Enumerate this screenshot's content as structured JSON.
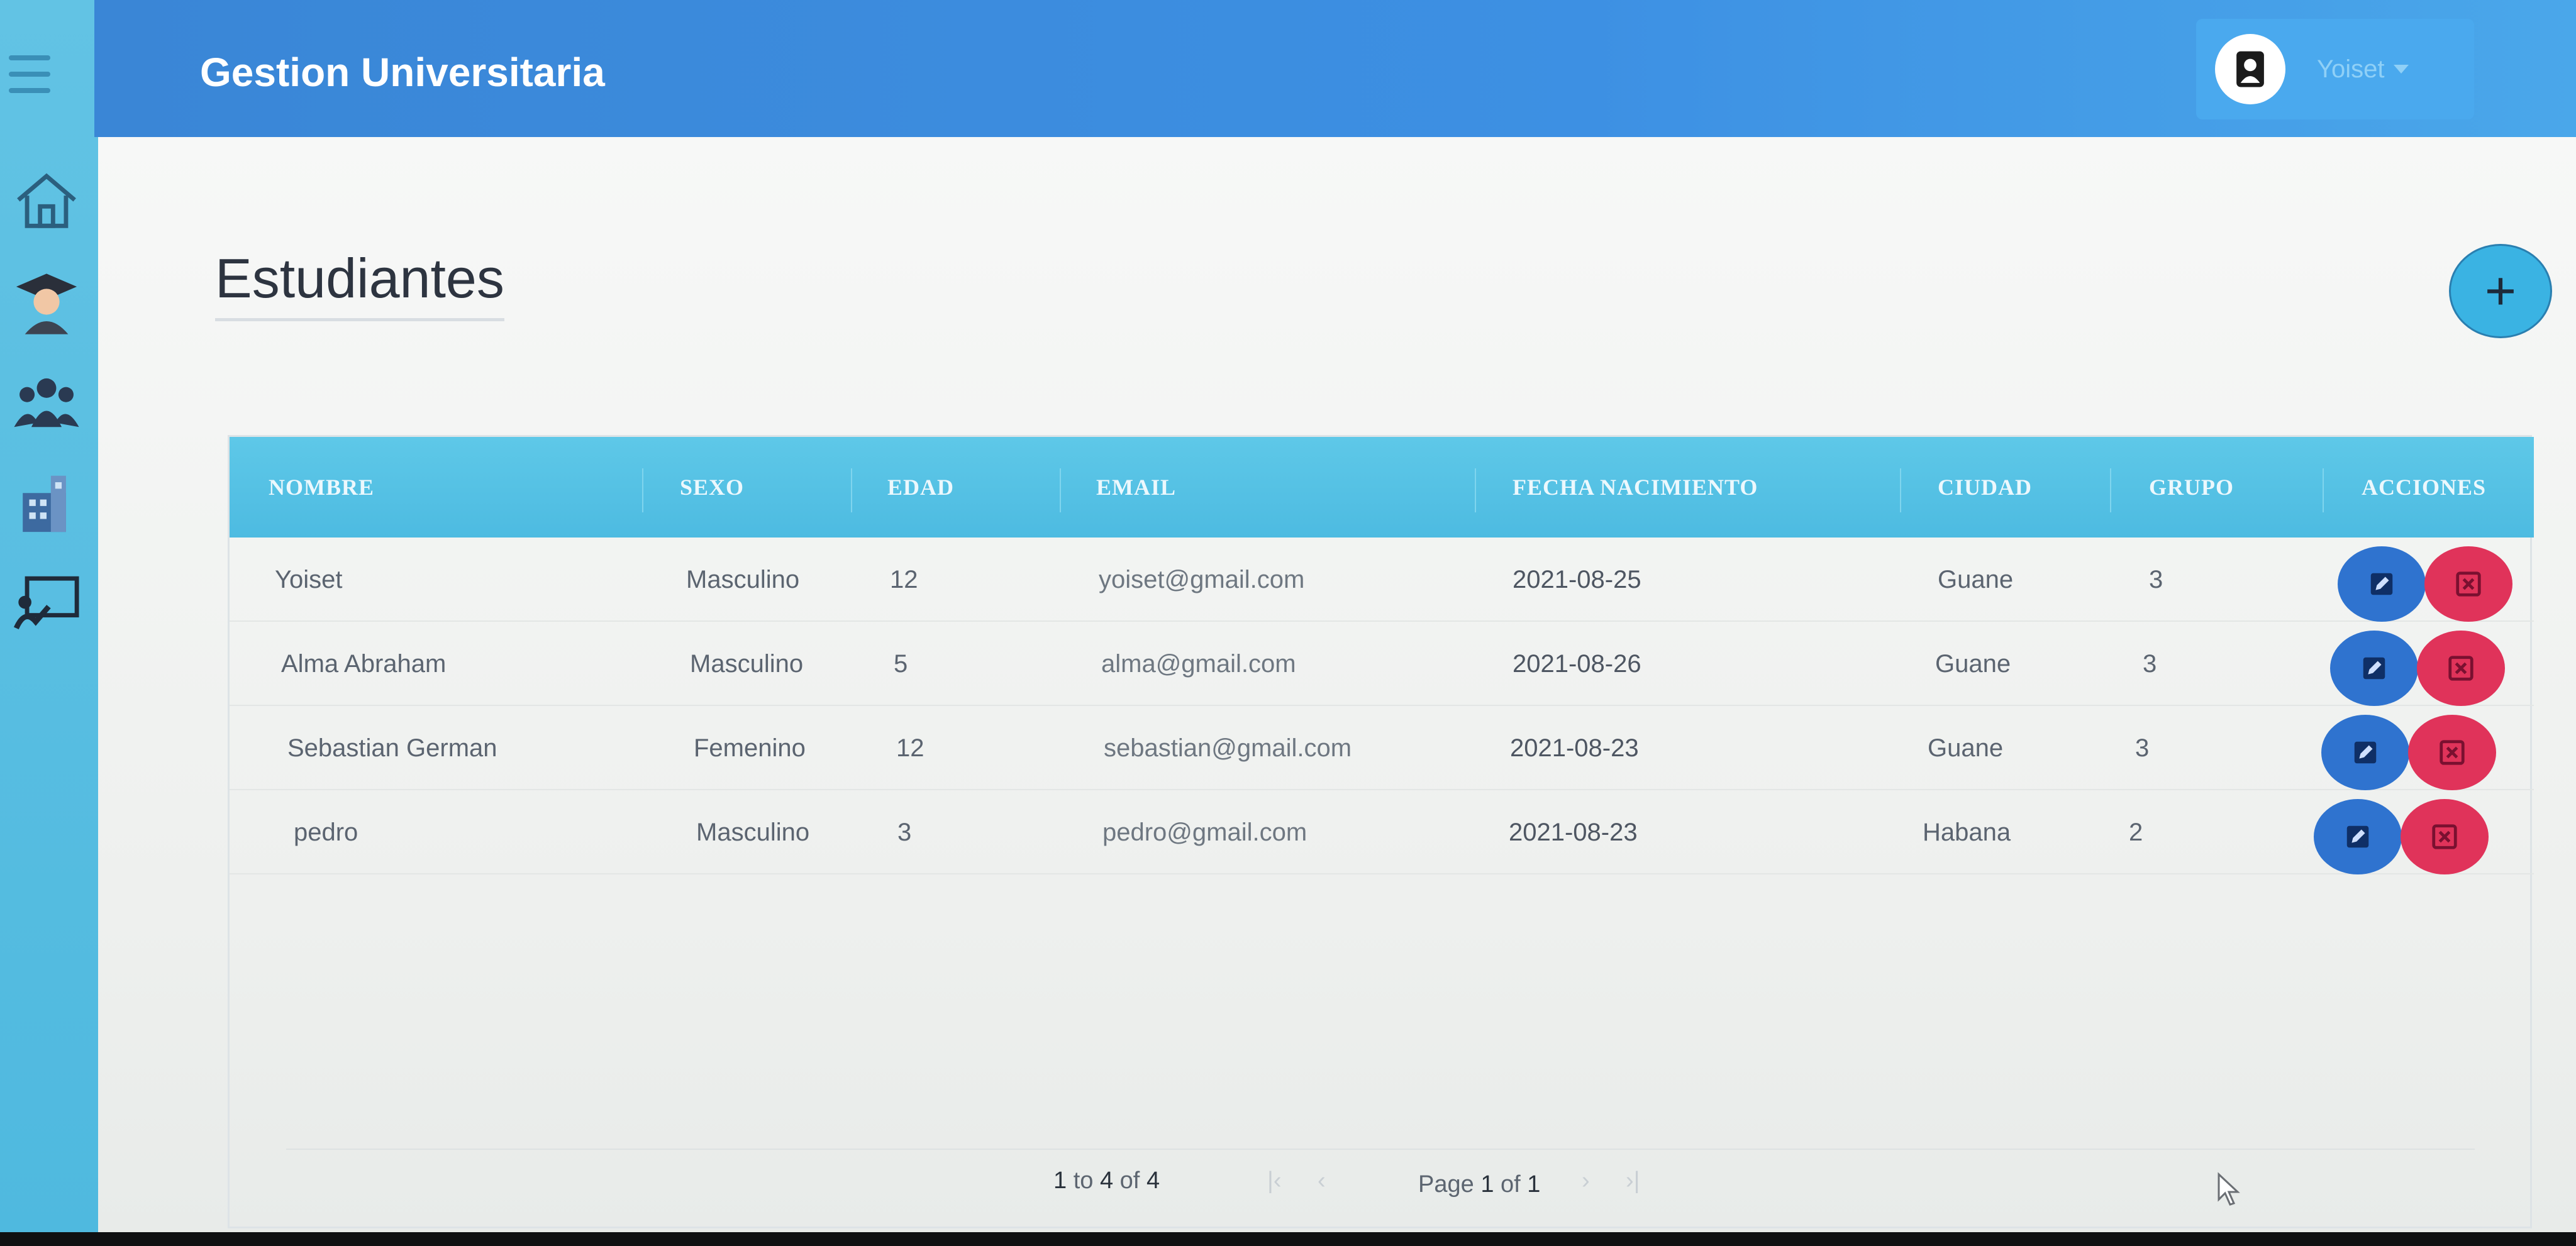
{
  "app": {
    "title": "Gestion Universitaria",
    "user_name": "Yoiset"
  },
  "sidebar": {
    "items": [
      {
        "icon": "home-icon"
      },
      {
        "icon": "student-icon"
      },
      {
        "icon": "group-icon"
      },
      {
        "icon": "building-icon"
      },
      {
        "icon": "teacher-board-icon"
      }
    ]
  },
  "page": {
    "title": "Estudiantes",
    "add_label": "+"
  },
  "table": {
    "columns": [
      "NOMBRE",
      "SEXO",
      "EDAD",
      "EMAIL",
      "FECHA NACIMIENTO",
      "CIUDAD",
      "GRUPO",
      "ACCIONES"
    ],
    "rows": [
      {
        "nombre": "Yoiset",
        "sexo": "Masculino",
        "edad": "12",
        "email": "yoiset@gmail.com",
        "fecha": "2021-08-25",
        "ciudad": "Guane",
        "grupo": "3"
      },
      {
        "nombre": "Alma Abraham",
        "sexo": "Masculino",
        "edad": "5",
        "email": "alma@gmail.com",
        "fecha": "2021-08-26",
        "ciudad": "Guane",
        "grupo": "3"
      },
      {
        "nombre": "Sebastian German",
        "sexo": "Femenino",
        "edad": "12",
        "email": "sebastian@gmail.com",
        "fecha": "2021-08-23",
        "ciudad": "Guane",
        "grupo": "3"
      },
      {
        "nombre": "pedro",
        "sexo": "Masculino",
        "edad": "3",
        "email": "pedro@gmail.com",
        "fecha": "2021-08-23",
        "ciudad": "Habana",
        "grupo": "2"
      }
    ]
  },
  "pagination": {
    "from": "1",
    "to_word": "to",
    "to": "4",
    "of_word": "of",
    "total": "4",
    "page_word": "Page",
    "page": "1",
    "pages": "1"
  },
  "colors": {
    "topbar": "#3d90e3",
    "sidebar": "#5ec0e2",
    "header": "#4dbbe1",
    "edit": "#2f73cf",
    "delete": "#e0335a"
  }
}
